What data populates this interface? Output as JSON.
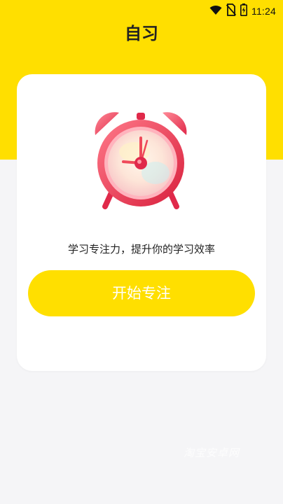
{
  "status_bar": {
    "time": "11:24",
    "icons": [
      "wifi-icon",
      "sim-off-icon",
      "battery-charging-icon"
    ]
  },
  "header": {
    "title": "自习"
  },
  "card": {
    "illustration": "alarm-clock-icon",
    "tagline": "学习专注力，提升你的学习效率",
    "start_button_label": "开始专注"
  },
  "watermark": {
    "text": "淘宝安卓网"
  },
  "colors": {
    "accent": "#ffdf00",
    "background": "#f5f5f7",
    "card": "#ffffff",
    "clock_red": "#e8334a"
  }
}
